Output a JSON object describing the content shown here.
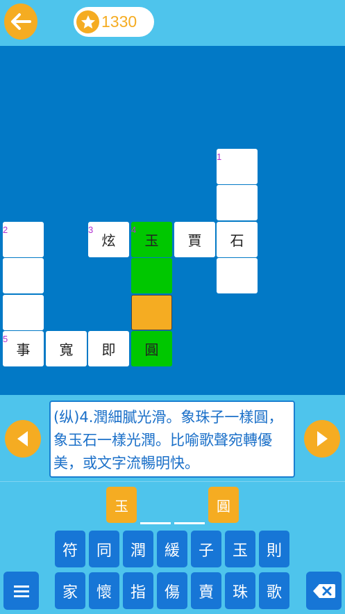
{
  "header": {
    "score": "1330",
    "icons": {
      "back": "arrow-left-icon",
      "score": "star-icon"
    }
  },
  "board": {
    "clue_numbers": [
      "1",
      "2",
      "3",
      "4",
      "5"
    ],
    "cells": {
      "c1a": "",
      "c1b": "",
      "r3_xuan": "炫",
      "r3_yu": "玉",
      "r3_jia": "賈",
      "r3_shi": "石",
      "c1d": "",
      "c2a": "",
      "c2b": "",
      "c2c": "",
      "c4b": "",
      "c4c": "",
      "c4d": "圓",
      "r5_shi": "事",
      "r5_kuan": "寬",
      "r5_ji": "即"
    },
    "colors": {
      "active_word": "#00c700",
      "current_cell": "#f5ac22"
    }
  },
  "clue": {
    "text": "(纵)4.潤細膩光滑。象珠子一樣圓，象玉石一樣光潤。比喻歌聲宛轉優美，或文字流暢明快。"
  },
  "answer": {
    "slots": [
      "玉",
      "",
      "",
      "圓"
    ]
  },
  "keyboard": {
    "row1": [
      "符",
      "同",
      "潤",
      "緩",
      "子",
      "玉",
      "則"
    ],
    "row2": [
      "家",
      "懷",
      "指",
      "傷",
      "賣",
      "珠",
      "歌"
    ]
  },
  "icons": {
    "prev": "triangle-left-icon",
    "next": "triangle-right-icon",
    "menu": "menu-icon",
    "delete": "backspace-icon"
  },
  "theme": {
    "header_bg": "#4ec4ec",
    "board_bg": "#0279c6",
    "accent": "#f5ac22",
    "key_bg": "#1776d6"
  }
}
